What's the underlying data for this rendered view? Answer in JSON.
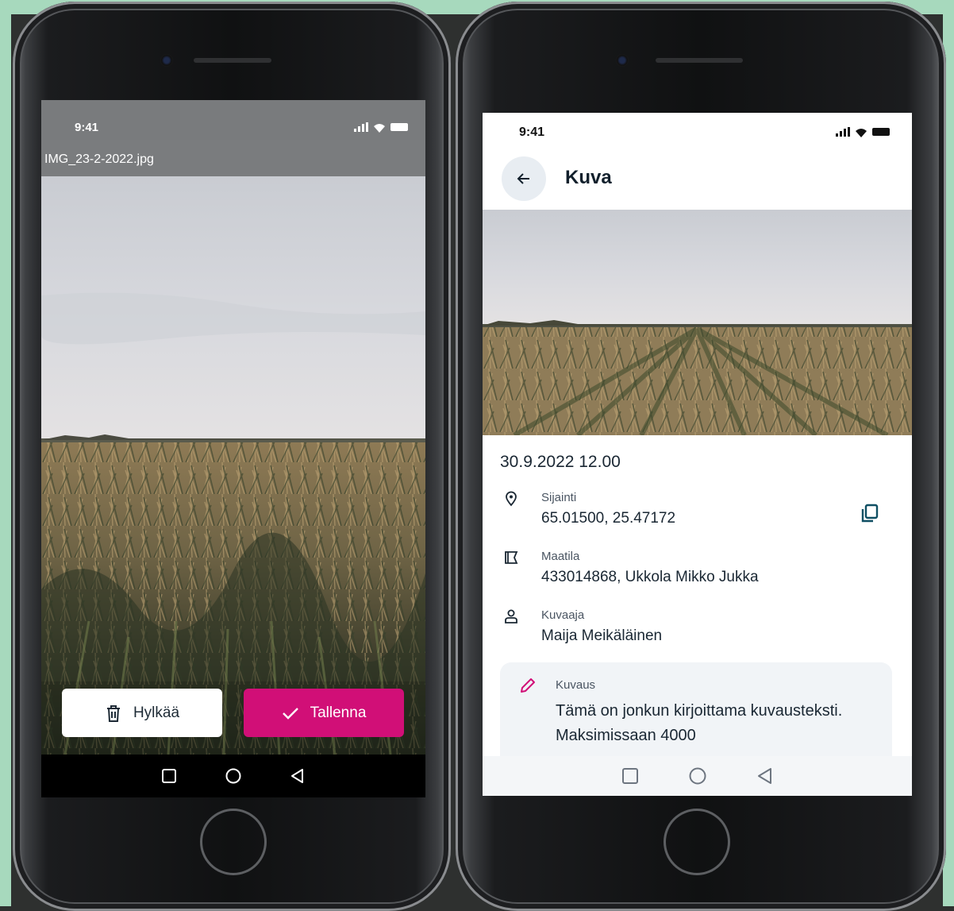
{
  "left_phone": {
    "status": {
      "time": "9:41"
    },
    "file_name": "IMG_23-2-2022.jpg",
    "actions": {
      "reject_label": "Hylkää",
      "save_label": "Tallenna"
    },
    "nav": {
      "icons": [
        "square-icon",
        "circle-icon",
        "triangle-back-icon"
      ]
    }
  },
  "right_phone": {
    "status": {
      "time": "9:41"
    },
    "header": {
      "title": "Kuva",
      "back_icon": "arrow-left-icon"
    },
    "datetime": "30.9.2022 12.00",
    "location": {
      "label": "Sijainti",
      "value": "65.01500, 25.47172",
      "icon": "location-pin-icon",
      "copy_icon": "copy-icon"
    },
    "farm": {
      "label": "Maatila",
      "value": "433014868, Ukkola Mikko Jukka",
      "icon": "field-icon"
    },
    "photographer": {
      "label": "Kuvaaja",
      "value": "Maija Meikäläinen",
      "icon": "person-icon"
    },
    "description": {
      "label": "Kuvaus",
      "text": "Tämä on jonkun kirjoittama kuvausteksti. Maksimissaan 4000",
      "icon": "pencil-icon"
    },
    "nav": {
      "icons": [
        "square-icon",
        "circle-icon",
        "triangle-back-icon"
      ]
    }
  },
  "colors": {
    "accent": "#d10f77",
    "background_band": "#a7d9bd",
    "text_dark": "#1a2733"
  }
}
